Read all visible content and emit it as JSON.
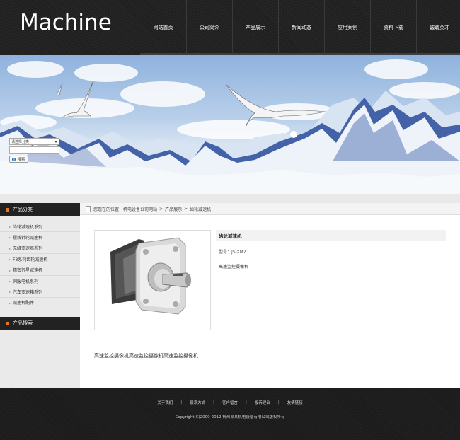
{
  "header": {
    "logo": "Machine",
    "nav": [
      "网站首页",
      "公司简介",
      "产品展示",
      "新闻动态",
      "应用案例",
      "资料下载",
      "诚聘英才"
    ]
  },
  "sidebar": {
    "category_title": "产品分类",
    "categories": [
      "齿轮减速机系列",
      "摆线针轮减速机",
      "无级变速器系列",
      "F3系列齿轮减速机",
      "精密行星减速机",
      "伺服电机系列",
      "汽车变速箱系列",
      "减速机配件"
    ],
    "search_title": "产品搜索",
    "search": {
      "select_value": "请选择分类",
      "keyword_value": "",
      "button_label": "搜索"
    }
  },
  "breadcrumb": {
    "prefix": "您现在的位置：",
    "items": [
      "机电设备公司网站",
      "产品展示",
      "齿轮减速机"
    ],
    "separator": ">"
  },
  "product": {
    "title": "齿轮减速机",
    "model": "型号：JS-XM2",
    "short_desc": "高速监控摄像机",
    "detail": "高速监控摄像机高速监控摄像机高速监控摄像机"
  },
  "footer": {
    "links": [
      "关于我们",
      "联系方式",
      "客户留言",
      "投诉建议",
      "友情链接"
    ],
    "separator": "|",
    "copyright": "Copyright(C)2009-2012 杭州某某机电设备有限公司版权所有"
  },
  "colors": {
    "accent": "#e0782a",
    "header_bg": "#1f1f1f",
    "sidebar_head_bg": "#222222"
  }
}
